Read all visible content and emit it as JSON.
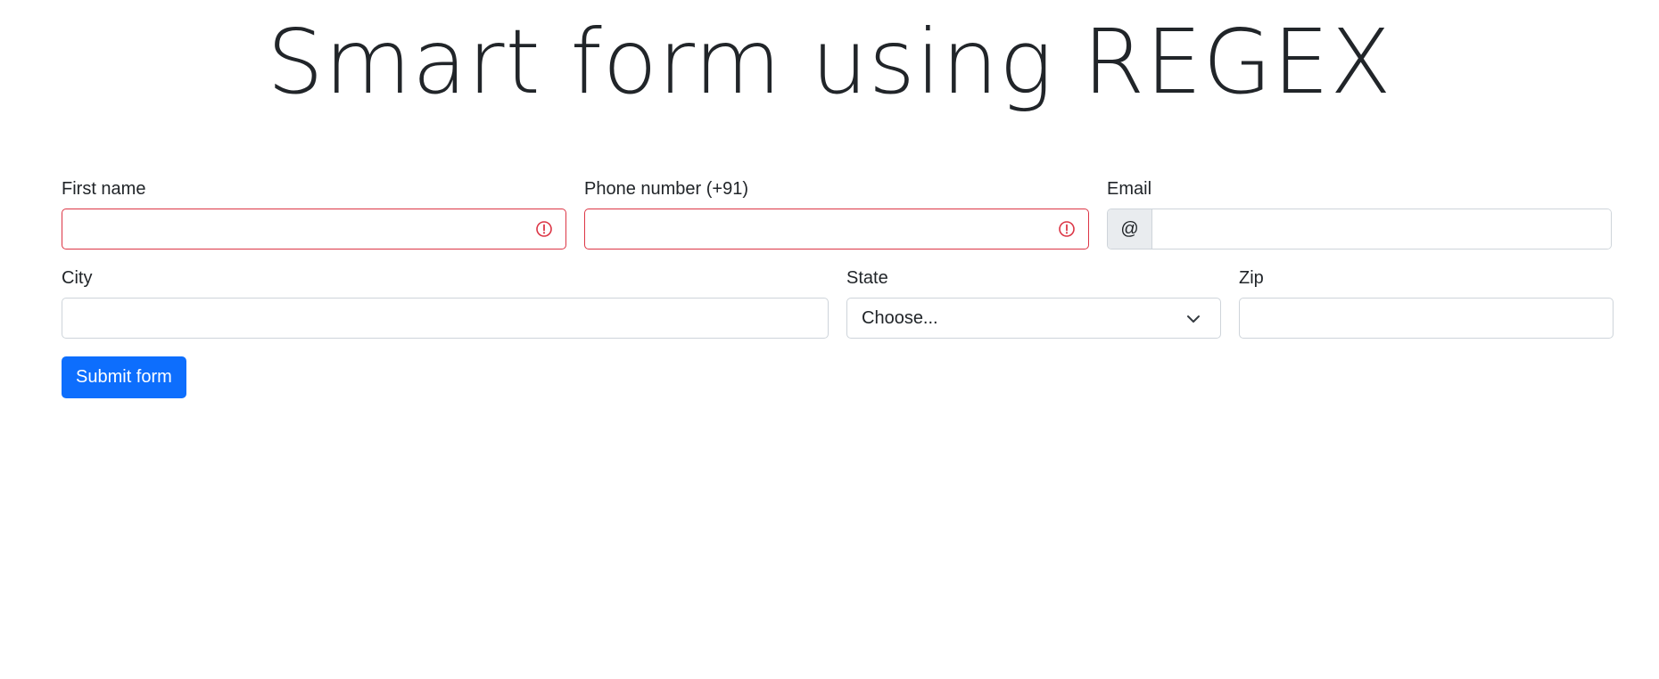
{
  "page": {
    "title": "Smart form using REGEX"
  },
  "form": {
    "first_name": {
      "label": "First name",
      "value": "",
      "status": "invalid",
      "icon": "exclamation-circle-icon"
    },
    "phone": {
      "label": "Phone number (+91)",
      "value": "",
      "status": "invalid",
      "icon": "exclamation-circle-icon"
    },
    "email": {
      "label": "Email",
      "prefix": "@",
      "value": ""
    },
    "city": {
      "label": "City",
      "value": ""
    },
    "state": {
      "label": "State",
      "selected": "Choose...",
      "icon": "chevron-down-icon"
    },
    "zip": {
      "label": "Zip",
      "value": ""
    },
    "submit_label": "Submit form"
  },
  "colors": {
    "accent": "#0d6efd",
    "invalid": "#dc3545",
    "border": "#ced4da",
    "addon_bg": "#e9ecef",
    "text": "#212529"
  }
}
